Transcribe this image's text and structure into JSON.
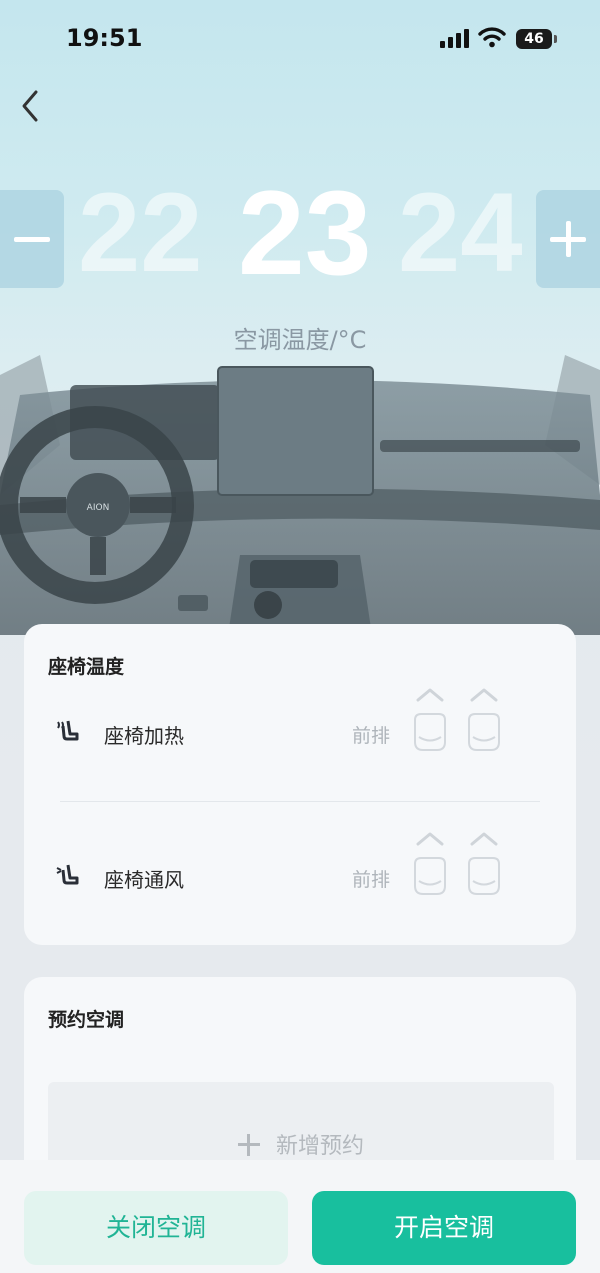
{
  "status_bar": {
    "time": "19:51",
    "battery": "46"
  },
  "temperature": {
    "prev": "22",
    "current": "23",
    "next": "24",
    "label": "空调温度/°C"
  },
  "seat_card": {
    "title": "座椅温度",
    "rows": [
      {
        "icon": "seat-heat-icon",
        "label": "座椅加热",
        "position": "前排"
      },
      {
        "icon": "seat-vent-icon",
        "label": "座椅通风",
        "position": "前排"
      }
    ]
  },
  "booking_card": {
    "title": "预约空调",
    "add_label": "新增预约"
  },
  "actions": {
    "off_label": "关闭空调",
    "on_label": "开启空调"
  },
  "colors": {
    "accent": "#18bf9e",
    "accent_light": "#e2f4ef"
  }
}
